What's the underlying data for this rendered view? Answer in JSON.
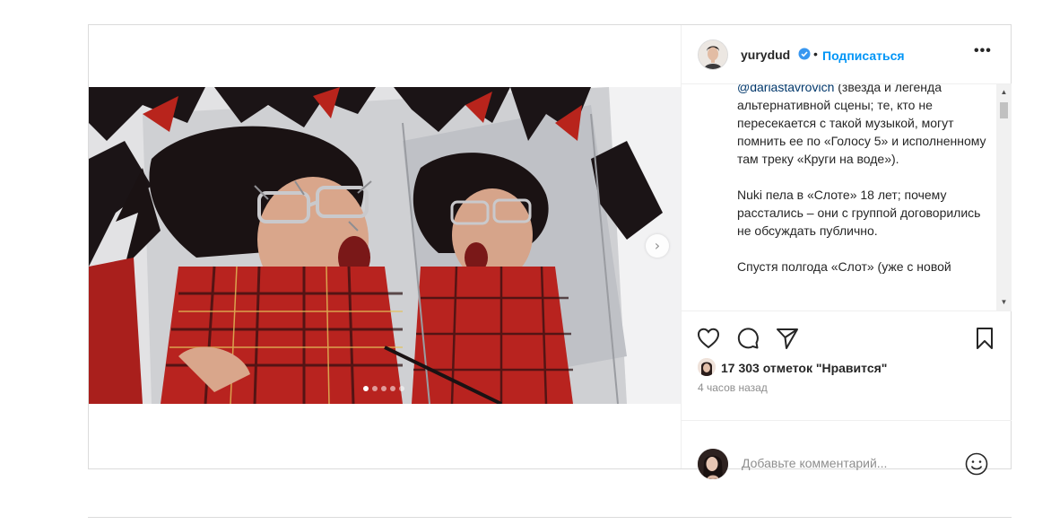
{
  "post": {
    "username": "yurydud",
    "follow_label": "Подписаться",
    "more_label": "•••",
    "caption_paragraphs": [
      {
        "mention": "@dariastavrovich",
        "text": " (звезда и легенда альтернативной сцены; те, кто не пересекается с такой музыкой, могут помнить ее по «Голосу 5» и исполненному там треку «Круги на воде»)."
      },
      {
        "mention": "",
        "text": "Nuki пела в «Слоте» 18 лет; почему расстались – они с группой договорились не обсуждать публично."
      },
      {
        "mention": "",
        "text": "Спустя полгода «Слот» (уже с новой"
      }
    ],
    "likes_text": "17 303 отметок \"Нравится\"",
    "time_ago": "4 часов назад",
    "comment_placeholder": "Добавьте комментарий...",
    "carousel": {
      "total_slides": 5,
      "active_slide": 1
    },
    "icons": {
      "like": "heart-icon",
      "comment": "comment-icon",
      "share": "paper-plane-icon",
      "save": "bookmark-icon",
      "verified": "verified-badge-icon",
      "emoji": "smiley-icon",
      "next": "chevron-right-icon"
    },
    "colors": {
      "link_blue": "#0095f6",
      "mention": "#00376b",
      "muted": "#8e8e8e",
      "border": "#dbdbdb"
    }
  }
}
